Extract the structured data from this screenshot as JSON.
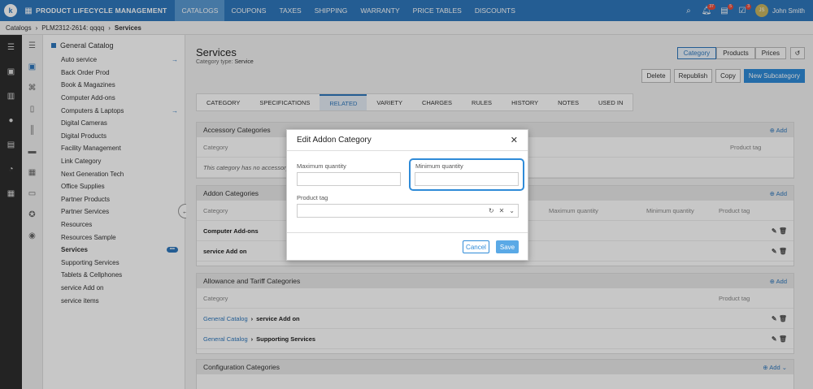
{
  "topbar": {
    "logo": "k",
    "brand": "PRODUCT LIFECYCLE MANAGEMENT",
    "nav": [
      "CATALOGS",
      "COUPONS",
      "TAXES",
      "SHIPPING",
      "WARRANTY",
      "PRICE TABLES",
      "DISCOUNTS"
    ],
    "badges": {
      "notifications": "37",
      "tasks": "5",
      "messages": "3"
    },
    "user_name": "John Smith",
    "user_initials": "JS"
  },
  "breadcrumb": [
    "Catalogs",
    "PLM2312-2614: qqqq",
    "Services"
  ],
  "tree": {
    "root": "General Catalog",
    "items": [
      {
        "label": "Auto service",
        "arrow": true
      },
      {
        "label": "Back Order Prod"
      },
      {
        "label": "Book & Magazines"
      },
      {
        "label": "Computer Add-ons"
      },
      {
        "label": "Computers & Laptops",
        "arrow": true
      },
      {
        "label": "Digital Cameras"
      },
      {
        "label": "Digital Products"
      },
      {
        "label": "Facility Management"
      },
      {
        "label": "Link Category"
      },
      {
        "label": "Next Generation Tech"
      },
      {
        "label": "Office Supplies"
      },
      {
        "label": "Partner Products"
      },
      {
        "label": "Partner Services"
      },
      {
        "label": "Resources"
      },
      {
        "label": "Resources Sample"
      },
      {
        "label": "Services",
        "selected": true
      },
      {
        "label": "Supporting Services"
      },
      {
        "label": "Tablets & Cellphones"
      },
      {
        "label": "service Add on"
      },
      {
        "label": "service items"
      }
    ]
  },
  "main": {
    "title": "Services",
    "category_type_label": "Category type:",
    "category_type": "Service",
    "view_toggle": [
      "Category",
      "Products",
      "Prices"
    ],
    "actions": [
      "Delete",
      "Republish",
      "Copy",
      "New Subcategory"
    ],
    "tabs": [
      "CATEGORY",
      "SPECIFICATIONS",
      "RELATED",
      "VARIETY",
      "CHARGES",
      "RULES",
      "HISTORY",
      "NOTES",
      "USED IN"
    ],
    "active_tab": "RELATED",
    "accessory": {
      "title": "Accessory Categories",
      "add": "Add",
      "col_category": "Category",
      "col_product_tag": "Product tag",
      "empty": "This category has no accessory categories"
    },
    "addon": {
      "title": "Addon Categories",
      "add": "Add",
      "col_category": "Category",
      "col_max": "Maximum quantity",
      "col_min": "Minimum quantity",
      "col_product_tag": "Product tag",
      "rows": [
        "Computer Add-ons",
        "service Add on"
      ]
    },
    "allowance": {
      "title": "Allowance and Tariff Categories",
      "add": "Add",
      "col_category": "Category",
      "col_product_tag": "Product tag",
      "rows": [
        {
          "parent": "General Catalog",
          "name": "service Add on"
        },
        {
          "parent": "General Catalog",
          "name": "Supporting Services"
        }
      ]
    },
    "configuration": {
      "title": "Configuration Categories",
      "add": "Add"
    }
  },
  "modal": {
    "title": "Edit Addon Category",
    "max_label": "Maximum quantity",
    "max_value": "",
    "min_label": "Minimum quantity",
    "min_value": "",
    "tag_label": "Product tag",
    "tag_value": "",
    "cancel": "Cancel",
    "save": "Save"
  },
  "colors": {
    "brand": "#2f78bd",
    "primary_button": "#2f8bd8",
    "save_button": "#5aa9e6"
  }
}
